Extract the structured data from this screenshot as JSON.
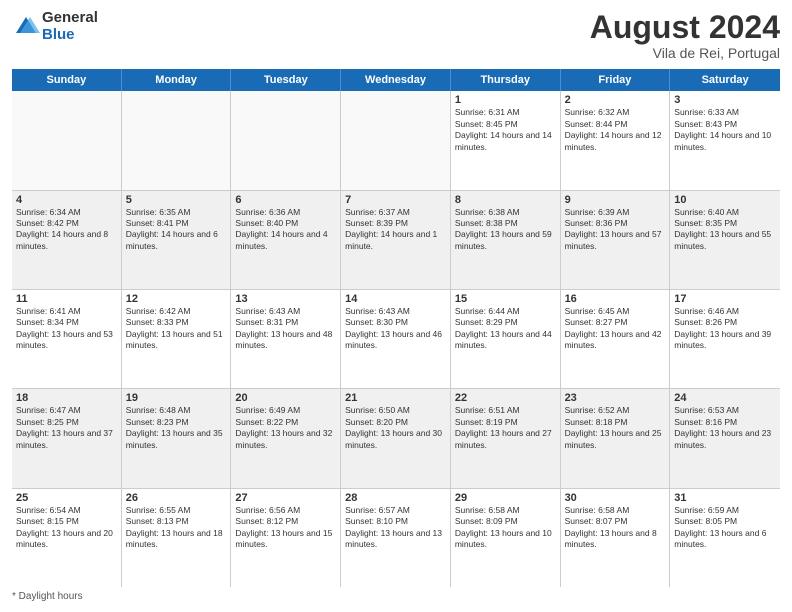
{
  "header": {
    "logo_general": "General",
    "logo_blue": "Blue",
    "month_title": "August 2024",
    "subtitle": "Vila de Rei, Portugal"
  },
  "days_of_week": [
    "Sunday",
    "Monday",
    "Tuesday",
    "Wednesday",
    "Thursday",
    "Friday",
    "Saturday"
  ],
  "footer": {
    "note": "Daylight hours"
  },
  "weeks": [
    [
      {
        "day": "",
        "empty": true
      },
      {
        "day": "",
        "empty": true
      },
      {
        "day": "",
        "empty": true
      },
      {
        "day": "",
        "empty": true
      },
      {
        "day": "1",
        "sunrise": "6:31 AM",
        "sunset": "8:45 PM",
        "daylight": "14 hours and 14 minutes."
      },
      {
        "day": "2",
        "sunrise": "6:32 AM",
        "sunset": "8:44 PM",
        "daylight": "14 hours and 12 minutes."
      },
      {
        "day": "3",
        "sunrise": "6:33 AM",
        "sunset": "8:43 PM",
        "daylight": "14 hours and 10 minutes."
      }
    ],
    [
      {
        "day": "4",
        "sunrise": "6:34 AM",
        "sunset": "8:42 PM",
        "daylight": "14 hours and 8 minutes."
      },
      {
        "day": "5",
        "sunrise": "6:35 AM",
        "sunset": "8:41 PM",
        "daylight": "14 hours and 6 minutes."
      },
      {
        "day": "6",
        "sunrise": "6:36 AM",
        "sunset": "8:40 PM",
        "daylight": "14 hours and 4 minutes."
      },
      {
        "day": "7",
        "sunrise": "6:37 AM",
        "sunset": "8:39 PM",
        "daylight": "14 hours and 1 minute."
      },
      {
        "day": "8",
        "sunrise": "6:38 AM",
        "sunset": "8:38 PM",
        "daylight": "13 hours and 59 minutes."
      },
      {
        "day": "9",
        "sunrise": "6:39 AM",
        "sunset": "8:36 PM",
        "daylight": "13 hours and 57 minutes."
      },
      {
        "day": "10",
        "sunrise": "6:40 AM",
        "sunset": "8:35 PM",
        "daylight": "13 hours and 55 minutes."
      }
    ],
    [
      {
        "day": "11",
        "sunrise": "6:41 AM",
        "sunset": "8:34 PM",
        "daylight": "13 hours and 53 minutes."
      },
      {
        "day": "12",
        "sunrise": "6:42 AM",
        "sunset": "8:33 PM",
        "daylight": "13 hours and 51 minutes."
      },
      {
        "day": "13",
        "sunrise": "6:43 AM",
        "sunset": "8:31 PM",
        "daylight": "13 hours and 48 minutes."
      },
      {
        "day": "14",
        "sunrise": "6:43 AM",
        "sunset": "8:30 PM",
        "daylight": "13 hours and 46 minutes."
      },
      {
        "day": "15",
        "sunrise": "6:44 AM",
        "sunset": "8:29 PM",
        "daylight": "13 hours and 44 minutes."
      },
      {
        "day": "16",
        "sunrise": "6:45 AM",
        "sunset": "8:27 PM",
        "daylight": "13 hours and 42 minutes."
      },
      {
        "day": "17",
        "sunrise": "6:46 AM",
        "sunset": "8:26 PM",
        "daylight": "13 hours and 39 minutes."
      }
    ],
    [
      {
        "day": "18",
        "sunrise": "6:47 AM",
        "sunset": "8:25 PM",
        "daylight": "13 hours and 37 minutes."
      },
      {
        "day": "19",
        "sunrise": "6:48 AM",
        "sunset": "8:23 PM",
        "daylight": "13 hours and 35 minutes."
      },
      {
        "day": "20",
        "sunrise": "6:49 AM",
        "sunset": "8:22 PM",
        "daylight": "13 hours and 32 minutes."
      },
      {
        "day": "21",
        "sunrise": "6:50 AM",
        "sunset": "8:20 PM",
        "daylight": "13 hours and 30 minutes."
      },
      {
        "day": "22",
        "sunrise": "6:51 AM",
        "sunset": "8:19 PM",
        "daylight": "13 hours and 27 minutes."
      },
      {
        "day": "23",
        "sunrise": "6:52 AM",
        "sunset": "8:18 PM",
        "daylight": "13 hours and 25 minutes."
      },
      {
        "day": "24",
        "sunrise": "6:53 AM",
        "sunset": "8:16 PM",
        "daylight": "13 hours and 23 minutes."
      }
    ],
    [
      {
        "day": "25",
        "sunrise": "6:54 AM",
        "sunset": "8:15 PM",
        "daylight": "13 hours and 20 minutes."
      },
      {
        "day": "26",
        "sunrise": "6:55 AM",
        "sunset": "8:13 PM",
        "daylight": "13 hours and 18 minutes."
      },
      {
        "day": "27",
        "sunrise": "6:56 AM",
        "sunset": "8:12 PM",
        "daylight": "13 hours and 15 minutes."
      },
      {
        "day": "28",
        "sunrise": "6:57 AM",
        "sunset": "8:10 PM",
        "daylight": "13 hours and 13 minutes."
      },
      {
        "day": "29",
        "sunrise": "6:58 AM",
        "sunset": "8:09 PM",
        "daylight": "13 hours and 10 minutes."
      },
      {
        "day": "30",
        "sunrise": "6:58 AM",
        "sunset": "8:07 PM",
        "daylight": "13 hours and 8 minutes."
      },
      {
        "day": "31",
        "sunrise": "6:59 AM",
        "sunset": "8:05 PM",
        "daylight": "13 hours and 6 minutes."
      }
    ]
  ]
}
